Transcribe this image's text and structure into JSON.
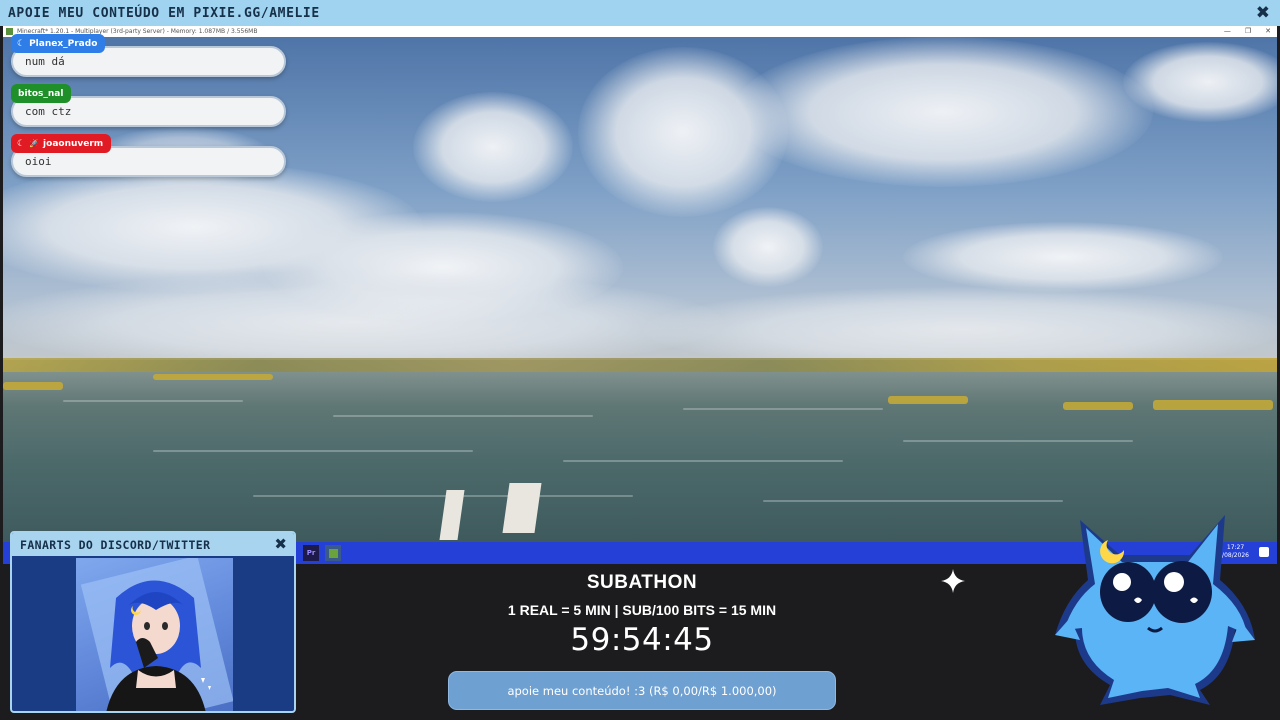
{
  "banner": {
    "text": "APOIE MEU CONTEÚDO EM PIXIE.GG/AMELIE",
    "close_glyph": "✖"
  },
  "game_window": {
    "title": "Minecraft* 1.20.1 - Multiplayer (3rd-party Server) - Memory: 1.087MB / 3.556MB",
    "controls": [
      "—",
      "❐",
      "✕"
    ],
    "taskbar": {
      "clock_time": "17:27",
      "clock_date": "/08/2026",
      "apps": [
        {
          "label": "Pr",
          "icon": "premiere-pro-icon",
          "color": "#9b8cff"
        },
        {
          "label": "",
          "icon": "minecraft-icon",
          "color": "#6aa33b"
        }
      ]
    }
  },
  "chat": {
    "messages": [
      {
        "user": "Planex_Prado",
        "text": "num dá",
        "badge_color": "#2f7ee8",
        "icon": "moon-icon",
        "icon_glyph": "☾"
      },
      {
        "user": "bitos_nal",
        "text": "com ctz",
        "badge_color": "#1f8f2a",
        "icon": "",
        "icon_glyph": ""
      },
      {
        "user": "joaonuverm",
        "text": "oioi",
        "badge_color": "#e01b24",
        "icon": "moon-icon",
        "icon_glyph": "☾",
        "extra_icon": "rocket-icon",
        "extra_glyph": "🚀"
      }
    ]
  },
  "fanart": {
    "title": "FANARTS DO DISCORD/TWITTER",
    "close_glyph": "✖"
  },
  "subathon": {
    "title": "SUBATHON",
    "rates": "1 REAL = 5 MIN | SUB/100 BITS = 15 MIN",
    "timer": "59:54:45",
    "donate_label": "apoie meu conteúdo! :3 (R$ 0,00/R$ 1.000,00)"
  },
  "colors": {
    "banner": "#9fd3f0",
    "panel_blue": "#1a3c84",
    "donate_button": "#6ea0d2",
    "taskbar": "#2440d6",
    "mascot": "#5ab4f5"
  }
}
